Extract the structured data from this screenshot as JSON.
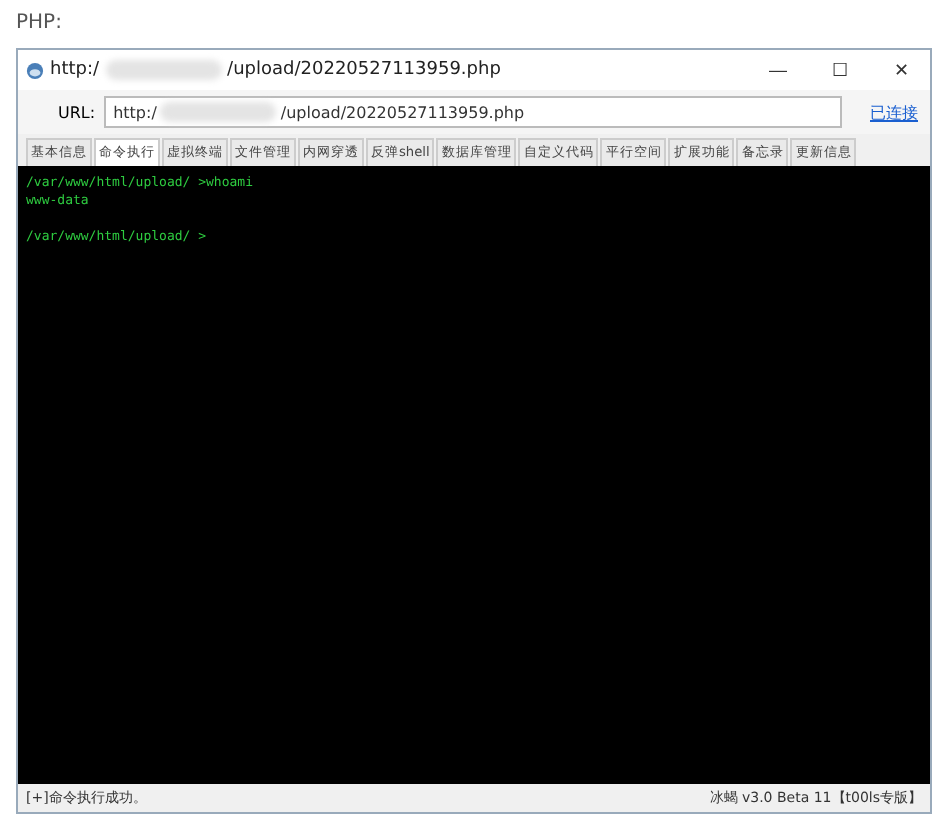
{
  "heading": "PHP:",
  "window": {
    "title_start": "http:/",
    "title_end": "/upload/20220527113959.php",
    "controls": [
      "—",
      "☐",
      "✕"
    ]
  },
  "url_bar": {
    "label": "URL:",
    "value_start": "http:/",
    "value_end": "/upload/20220527113959.php",
    "status": "已连接"
  },
  "tabs": [
    {
      "label": "基本信息",
      "selected": false
    },
    {
      "label": "命令执行",
      "selected": true
    },
    {
      "label": "虚拟终端",
      "selected": false
    },
    {
      "label": "文件管理",
      "selected": false
    },
    {
      "label": "内网穿透",
      "selected": false
    },
    {
      "label": "反弹shell",
      "selected": false
    },
    {
      "label": "数据库管理",
      "selected": false
    },
    {
      "label": "自定义代码",
      "selected": false
    },
    {
      "label": "平行空间",
      "selected": false
    },
    {
      "label": "扩展功能",
      "selected": false
    },
    {
      "label": "备忘录",
      "selected": false
    },
    {
      "label": "更新信息",
      "selected": false
    }
  ],
  "terminal": {
    "blocks": [
      [
        "/var/www/html/upload/ >whoami",
        "www-data"
      ],
      [
        "/var/www/html/upload/ >"
      ]
    ]
  },
  "status_bar": {
    "message": "[+]命令执行成功。",
    "version": "冰蝎 v3.0 Beta 11【t00ls专版】"
  }
}
